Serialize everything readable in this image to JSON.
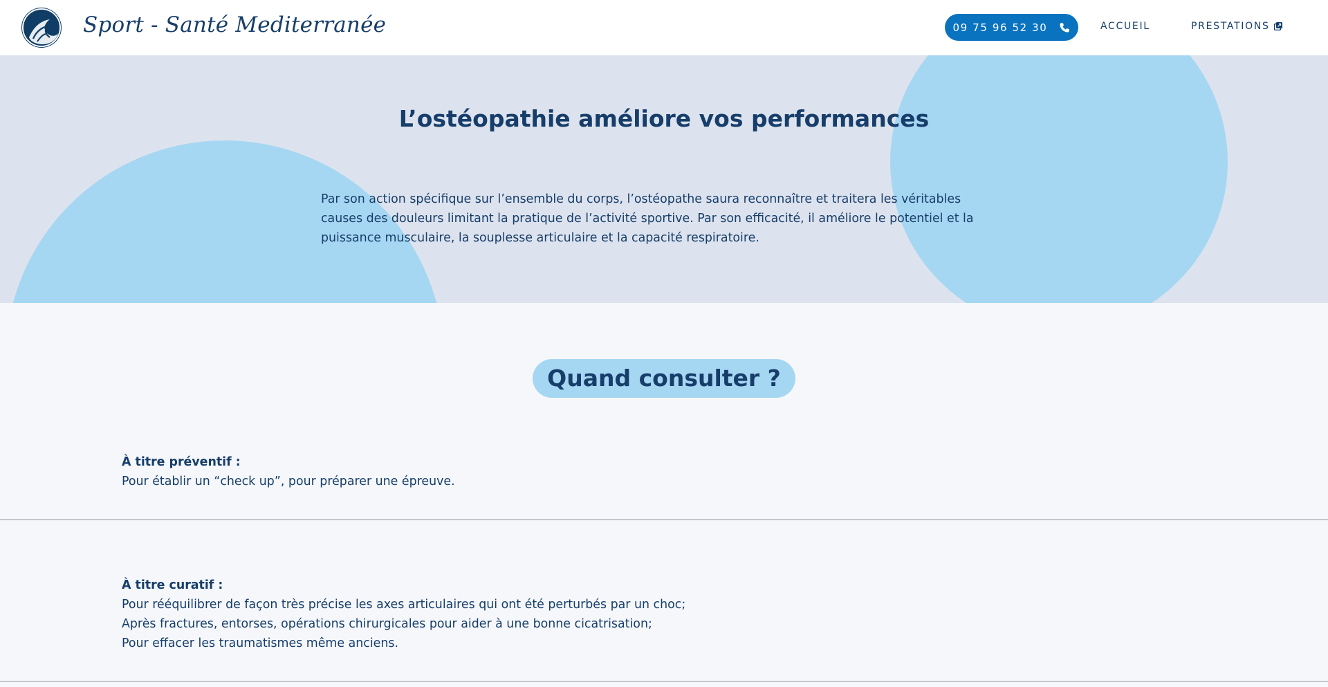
{
  "header": {
    "brand": "Sport - Santé Mediterranée",
    "logo_icon": "wave-logo-icon",
    "phone": "09 75 96 52 30",
    "phone_icon": "phone-icon",
    "nav": {
      "accueil": "ACCUEIL",
      "prestations": "PRESTATIONS",
      "prestations_icon": "external-link-icon"
    }
  },
  "hero": {
    "title": "L’ostéopathie améliore vos performances",
    "text": "Par son action spécifique sur l’ensemble du corps, l’ostéopathe saura reconnaître et traitera les véritables causes des douleurs limitant la pratique de l’activité sportive. Par son efficacité, il améliore le potentiel et la puissance musculaire, la souplesse articulaire et la capacité respiratoire."
  },
  "consult": {
    "title": "Quand consulter ?"
  },
  "sections": {
    "preventif": {
      "label": "À titre préventif :",
      "lines": [
        "Pour établir un “check up”, pour préparer une épreuve."
      ]
    },
    "curatif": {
      "label": "À titre curatif :",
      "lines": [
        "Pour rééquilibrer de façon très précise les axes articulaires qui ont été perturbés par un choc;",
        "Après fractures, entorses, opérations chirurgicales pour aider à une bonne cicatrisation;",
        "Pour effacer les traumatismes même anciens."
      ]
    }
  },
  "colors": {
    "primary": "#173e6a",
    "accent": "#0a73c0",
    "light_blue": "#a6d7f2",
    "hero_bg": "#dde3ee",
    "page_bg": "#f5f7fa"
  }
}
